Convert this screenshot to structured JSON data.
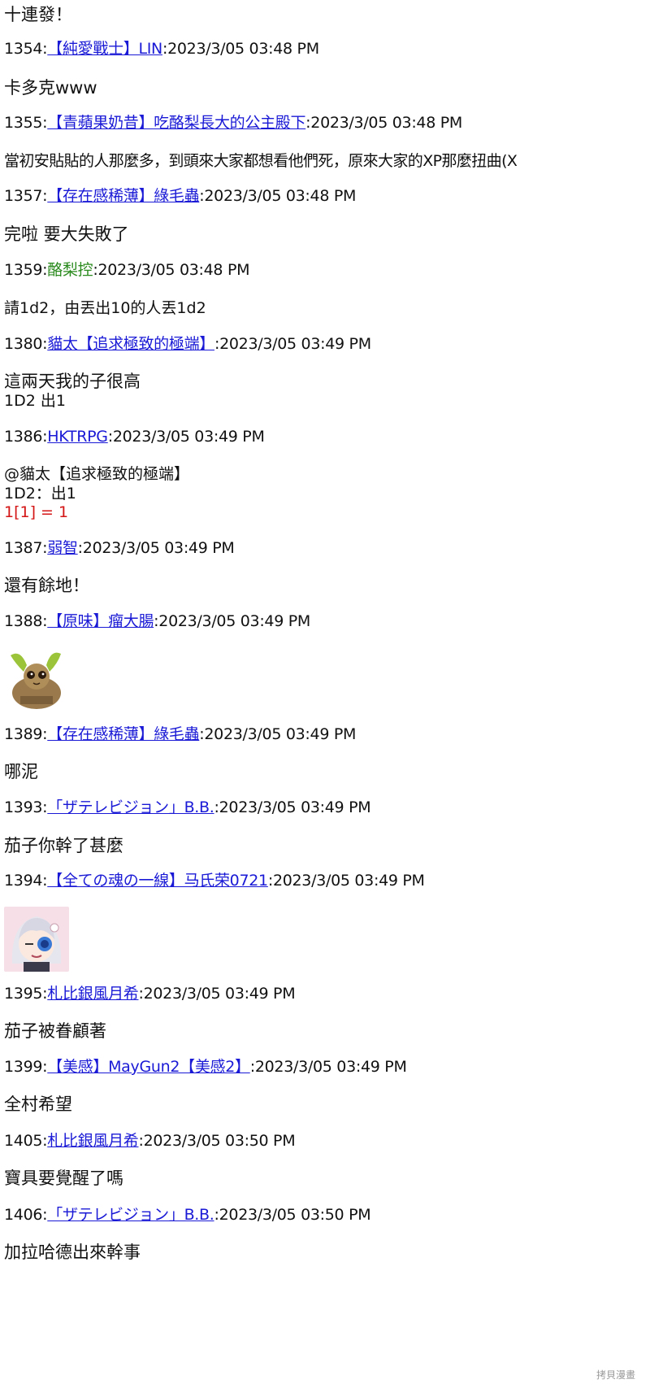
{
  "top_message": "十連發！",
  "posts": [
    {
      "no": "1354",
      "name": "【純愛戰士】LIN",
      "time": "2023/3/05 03:48 PM",
      "lines": [
        "卡多克www"
      ]
    },
    {
      "no": "1355",
      "name": "【青蘋果奶昔】吃酪梨長大的公主殿下",
      "time": "2023/3/05 03:48 PM",
      "lines": [
        "當初安貼貼的人那麼多，到頭來大家都想看他們死，原來大家的XP那麼扭曲(X"
      ]
    },
    {
      "no": "1357",
      "name": "【存在感稀薄】綠毛蟲",
      "time": "2023/3/05 03:48 PM",
      "lines": [
        "完啦 要大失敗了"
      ]
    },
    {
      "no": "1359",
      "name": "酪梨控",
      "time": "2023/3/05 03:48 PM",
      "lines": [
        "請1d2，由丟出10的人丟1d2"
      ]
    },
    {
      "no": "1380",
      "name": "貓太【追求極致的極端】",
      "time": "2023/3/05 03:49 PM",
      "lines": [
        "這兩天我的子很高",
        "1D2 出1"
      ]
    },
    {
      "no": "1386",
      "name": "HKTRPG",
      "time": "2023/3/05 03:49 PM",
      "lines": [
        "@貓太【追求極致的極端】",
        "1D2：出1"
      ],
      "dice": "1[1] = 1"
    },
    {
      "no": "1387",
      "name": "弱智",
      "time": "2023/3/05 03:49 PM",
      "lines": [
        "還有餘地！"
      ]
    },
    {
      "no": "1388",
      "name": "【原味】瘤大腸",
      "time": "2023/3/05 03:49 PM",
      "image": "loris-sticker"
    },
    {
      "no": "1389",
      "name": "【存在感稀薄】綠毛蟲",
      "time": "2023/3/05 03:49 PM",
      "lines": [
        "哪泥"
      ]
    },
    {
      "no": "1393",
      "name": "「ザテレビジョン」B.B.",
      "time": "2023/3/05 03:49 PM",
      "lines": [
        "茄子你幹了甚麼"
      ]
    },
    {
      "no": "1394",
      "name": "【全ての魂の一線】马氏荣0721",
      "time": "2023/3/05 03:49 PM",
      "image": "anime-girl-sticker"
    },
    {
      "no": "1395",
      "name": "札比銀風月希",
      "time": "2023/3/05 03:49 PM",
      "lines": [
        "茄子被眷顧著"
      ]
    },
    {
      "no": "1399",
      "name": "【美感】MayGun2【美感2】",
      "time": "2023/3/05 03:49 PM",
      "lines": [
        "全村希望"
      ]
    },
    {
      "no": "1405",
      "name": "札比銀風月希",
      "time": "2023/3/05 03:50 PM",
      "lines": [
        "寶具要覺醒了嗎"
      ]
    },
    {
      "no": "1406",
      "name": "「ザテレビジョン」B.B.",
      "time": "2023/3/05 03:50 PM",
      "lines": [
        "加拉哈德出來幹事"
      ]
    }
  ],
  "watermark": "拷貝漫畫",
  "colors": {
    "link": "#1a1ad6",
    "plain_name": "#2b8a1e",
    "dice": "#d41515",
    "text": "#111111"
  }
}
